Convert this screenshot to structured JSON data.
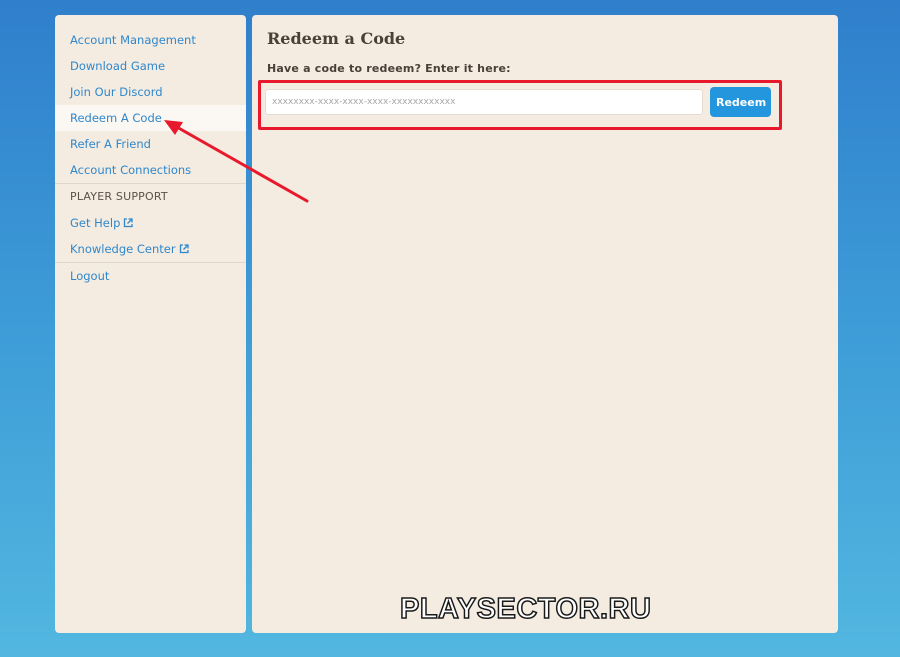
{
  "sidebar": {
    "items": [
      {
        "label": "Account Management"
      },
      {
        "label": "Download Game"
      },
      {
        "label": "Join Our Discord"
      },
      {
        "label": "Redeem A Code"
      },
      {
        "label": "Refer A Friend"
      },
      {
        "label": "Account Connections"
      }
    ],
    "support_heading": "PLAYER SUPPORT",
    "support_items": [
      {
        "label": "Get Help",
        "icon": "external-link-icon"
      },
      {
        "label": "Knowledge Center",
        "icon": "external-link-icon"
      }
    ],
    "logout_label": "Logout",
    "active_item": "Redeem A Code"
  },
  "main": {
    "title": "Redeem a Code",
    "prompt": "Have a code to redeem? Enter it here:",
    "code_input": {
      "placeholder": "xxxxxxxx-xxxx-xxxx-xxxx-xxxxxxxxxxxx",
      "value": ""
    },
    "redeem_label": "Redeem"
  },
  "watermark": "PLAYSECTOR.RU",
  "colors": {
    "accent": "#2496de",
    "link": "#2f88cc",
    "highlight": "#e8192c",
    "panel": "#f4ebe1"
  }
}
